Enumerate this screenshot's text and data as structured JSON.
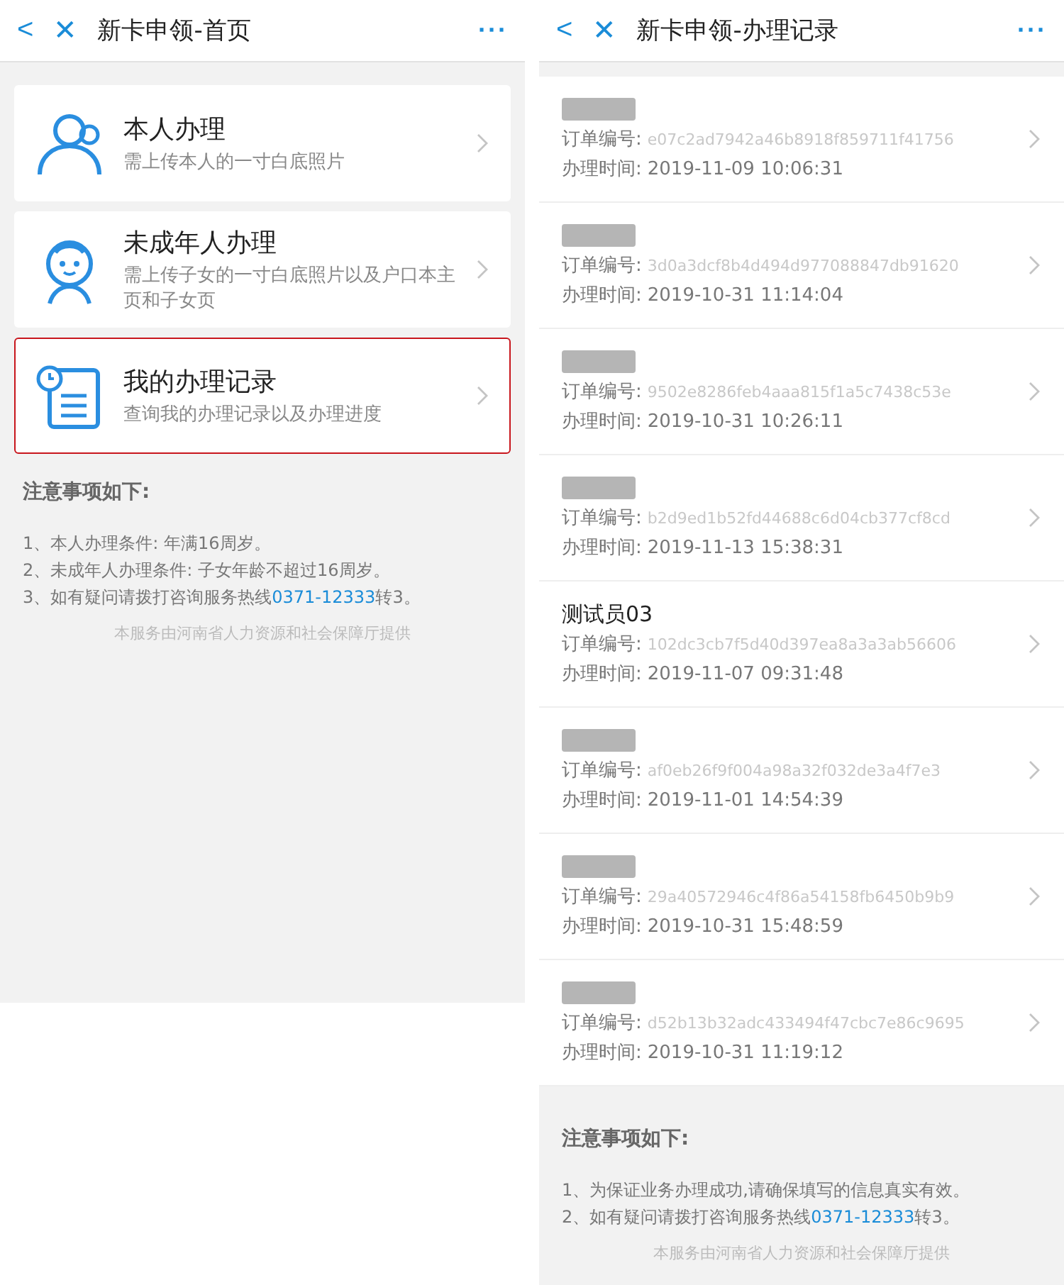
{
  "home": {
    "header": {
      "back": "<",
      "close": "✕",
      "title": "新卡申领-首页",
      "more": "···"
    },
    "options": [
      {
        "kind": "person",
        "title": "本人办理",
        "subtitle": "需上传本人的一寸白底照片",
        "selected": false
      },
      {
        "kind": "child",
        "title": "未成年人办理",
        "subtitle": "需上传子女的一寸白底照片以及户口本主页和子女页",
        "selected": false
      },
      {
        "kind": "records",
        "title": "我的办理记录",
        "subtitle": "查询我的办理记录以及办理进度",
        "selected": true
      }
    ],
    "notes": {
      "heading": "注意事项如下:",
      "items": [
        {
          "text": "1、本人办理条件: 年满16周岁。"
        },
        {
          "text": "2、未成年人办理条件: 子女年龄不超过16周岁。"
        },
        {
          "text": "3、如有疑问请拨打咨询服务热线",
          "link": "0371-12333",
          "after": "转3。"
        }
      ],
      "footer": "本服务由河南省人力资源和社会保障厅提供"
    }
  },
  "records": {
    "header": {
      "back": "<",
      "close": "✕",
      "title": "新卡申领-办理记录",
      "more": "···"
    },
    "rows": [
      {
        "redacted": true,
        "order_label": "订单编号:",
        "order": "e07c2ad7942a46b8918f859711f41756",
        "time_label": "办理时间:",
        "time": "2019-11-09 10:06:31"
      },
      {
        "redacted": true,
        "order_label": "订单编号:",
        "order": "3d0a3dcf8b4d494d977088847db91620",
        "time_label": "办理时间:",
        "time": "2019-10-31 11:14:04"
      },
      {
        "redacted": true,
        "order_label": "订单编号:",
        "order": "9502e8286feb4aaa815f1a5c7438c53e",
        "time_label": "办理时间:",
        "time": "2019-10-31 10:26:11"
      },
      {
        "redacted": true,
        "order_label": "订单编号:",
        "order": "b2d9ed1b52fd44688c6d04cb377cf8cd",
        "time_label": "办理时间:",
        "time": "2019-11-13 15:38:31"
      },
      {
        "redacted": false,
        "name": "测试员03",
        "order_label": "订单编号:",
        "order": "102dc3cb7f5d40d397ea8a3a3ab56606",
        "time_label": "办理时间:",
        "time": "2019-11-07 09:31:48"
      },
      {
        "redacted": true,
        "order_label": "订单编号:",
        "order": "af0eb26f9f004a98a32f032de3a4f7e3",
        "time_label": "办理时间:",
        "time": "2019-11-01 14:54:39"
      },
      {
        "redacted": true,
        "order_label": "订单编号:",
        "order": "29a40572946c4f86a54158fb6450b9b9",
        "time_label": "办理时间:",
        "time": "2019-10-31 15:48:59"
      },
      {
        "redacted": true,
        "order_label": "订单编号:",
        "order": "d52b13b32adc433494f47cbc7e86c9695",
        "time_label": "办理时间:",
        "time": "2019-10-31 11:19:12"
      }
    ],
    "notes": {
      "heading": "注意事项如下:",
      "items": [
        {
          "text": "1、为保证业务办理成功,请确保填写的信息真实有效。"
        },
        {
          "text": "2、如有疑问请拨打咨询服务热线",
          "link": "0371-12333",
          "after": "转3。"
        }
      ],
      "footer": "本服务由河南省人力资源和社会保障厅提供"
    }
  }
}
